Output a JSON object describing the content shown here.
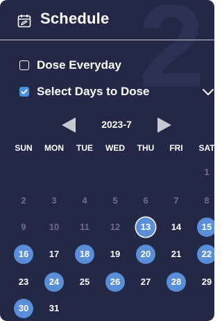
{
  "header": {
    "title": "Schedule",
    "icon": "calendar-edit-icon",
    "watermark": "2"
  },
  "options": {
    "dose_everyday": {
      "label": "Dose Everyday",
      "checked": false
    },
    "select_days": {
      "label": "Select Days to Dose",
      "checked": true
    }
  },
  "calendar": {
    "month_label": "2023-7",
    "weekdays": [
      "SUN",
      "MON",
      "TUE",
      "WED",
      "THU",
      "FRI",
      "SAT"
    ],
    "weeks": [
      [
        null,
        null,
        null,
        null,
        null,
        null,
        1
      ],
      [
        2,
        3,
        4,
        5,
        6,
        7,
        8
      ],
      [
        9,
        10,
        11,
        12,
        13,
        14,
        15
      ],
      [
        16,
        17,
        18,
        19,
        20,
        21,
        22
      ],
      [
        23,
        24,
        25,
        26,
        27,
        28,
        29
      ],
      [
        30,
        31,
        null,
        null,
        null,
        null,
        null
      ]
    ],
    "today": 13,
    "last_past_day": 12,
    "selected_days": [
      13,
      15,
      16,
      18,
      20,
      22,
      24,
      26,
      28,
      30
    ]
  },
  "colors": {
    "background": "#232847",
    "accent": "#5b8ed8",
    "checkbox_checked": "#4a8fe0",
    "past_day_text": "#6b7088",
    "divider": "#c9cbd6"
  }
}
